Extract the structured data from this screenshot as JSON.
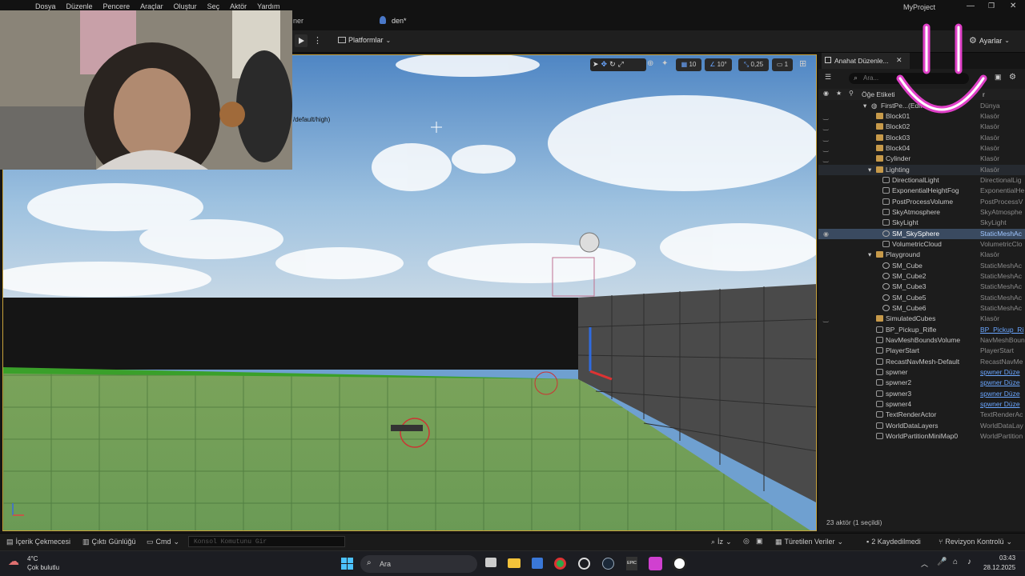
{
  "menu": [
    "Dosya",
    "Düzenle",
    "Pencere",
    "Araçlar",
    "Oluştur",
    "Seç",
    "Aktör",
    "Yardım"
  ],
  "window": {
    "project": "MyProject",
    "tab_partial": "ner",
    "level_tab": "den*"
  },
  "toolbar": {
    "platforms": "Platformlar",
    "settings": "Ayarlar"
  },
  "viewport": {
    "overlay_text": "/default/high)",
    "grid_value": "10",
    "rotation_value": "10°",
    "scale_value": "0,25",
    "camera_value": "1"
  },
  "outliner": {
    "tab_title": "Anahat Düzenle...",
    "search_placeholder": "Ara...",
    "col_label": "Öğe Etiketi",
    "col_type_partial": "r",
    "root": {
      "name": "FirstPe...(Editör)",
      "type": "Dünya"
    },
    "items": [
      {
        "name": "Block01",
        "type": "Klasör",
        "kind": "folder",
        "indent": 1,
        "eye": "closed"
      },
      {
        "name": "Block02",
        "type": "Klasör",
        "kind": "folder",
        "indent": 1,
        "eye": "closed"
      },
      {
        "name": "Block03",
        "type": "Klasör",
        "kind": "folder",
        "indent": 1,
        "eye": "closed"
      },
      {
        "name": "Block04",
        "type": "Klasör",
        "kind": "folder",
        "indent": 1,
        "eye": "closed"
      },
      {
        "name": "Cylinder",
        "type": "Klasör",
        "kind": "folder",
        "indent": 1,
        "eye": "closed"
      },
      {
        "name": "Lighting",
        "type": "Klasör",
        "kind": "folder-open",
        "indent": 1,
        "eye": "",
        "hl": true
      },
      {
        "name": "DirectionalLight",
        "type": "DirectionalLig",
        "kind": "actor",
        "indent": 2,
        "eye": ""
      },
      {
        "name": "ExponentialHeightFog",
        "type": "ExponentialHe",
        "kind": "actor",
        "indent": 2,
        "eye": ""
      },
      {
        "name": "PostProcessVolume",
        "type": "PostProcessV",
        "kind": "actor",
        "indent": 2,
        "eye": ""
      },
      {
        "name": "SkyAtmosphere",
        "type": "SkyAtmosphe",
        "kind": "actor",
        "indent": 2,
        "eye": ""
      },
      {
        "name": "SkyLight",
        "type": "SkyLight",
        "kind": "actor",
        "indent": 2,
        "eye": ""
      },
      {
        "name": "SM_SkySphere",
        "type": "StaticMeshAc",
        "kind": "mesh",
        "indent": 2,
        "eye": "open",
        "sel": true
      },
      {
        "name": "VolumetricCloud",
        "type": "VolumetricClo",
        "kind": "actor",
        "indent": 2,
        "eye": ""
      },
      {
        "name": "Playground",
        "type": "Klasör",
        "kind": "folder-open",
        "indent": 1,
        "eye": ""
      },
      {
        "name": "SM_Cube",
        "type": "StaticMeshAc",
        "kind": "mesh",
        "indent": 2,
        "eye": ""
      },
      {
        "name": "SM_Cube2",
        "type": "StaticMeshAc",
        "kind": "mesh",
        "indent": 2,
        "eye": ""
      },
      {
        "name": "SM_Cube3",
        "type": "StaticMeshAc",
        "kind": "mesh",
        "indent": 2,
        "eye": ""
      },
      {
        "name": "SM_Cube5",
        "type": "StaticMeshAc",
        "kind": "mesh",
        "indent": 2,
        "eye": ""
      },
      {
        "name": "SM_Cube6",
        "type": "StaticMeshAc",
        "kind": "mesh",
        "indent": 2,
        "eye": ""
      },
      {
        "name": "SimulatedCubes",
        "type": "Klasör",
        "kind": "folder",
        "indent": 1,
        "eye": "closed"
      },
      {
        "name": "BP_Pickup_Rifle",
        "type": "BP_Pickup_Ri",
        "kind": "actor",
        "indent": 1,
        "eye": "",
        "link": true
      },
      {
        "name": "NavMeshBoundsVolume",
        "type": "NavMeshBoun",
        "kind": "actor",
        "indent": 1,
        "eye": ""
      },
      {
        "name": "PlayerStart",
        "type": "PlayerStart",
        "kind": "actor",
        "indent": 1,
        "eye": ""
      },
      {
        "name": "RecastNavMesh-Default",
        "type": "RecastNavMe",
        "kind": "actor",
        "indent": 1,
        "eye": ""
      },
      {
        "name": "spwner",
        "type": "spwner Düze",
        "kind": "actor",
        "indent": 1,
        "eye": "",
        "link": true
      },
      {
        "name": "spwner2",
        "type": "spwner Düze",
        "kind": "actor",
        "indent": 1,
        "eye": "",
        "link": true
      },
      {
        "name": "spwner3",
        "type": "spwner Düze",
        "kind": "actor",
        "indent": 1,
        "eye": "",
        "link": true
      },
      {
        "name": "spwner4",
        "type": "spwner Düze",
        "kind": "actor",
        "indent": 1,
        "eye": "",
        "link": true
      },
      {
        "name": "TextRenderActor",
        "type": "TextRenderAc",
        "kind": "actor",
        "indent": 1,
        "eye": ""
      },
      {
        "name": "WorldDataLayers",
        "type": "WorldDataLay",
        "kind": "actor",
        "indent": 1,
        "eye": ""
      },
      {
        "name": "WorldPartitionMiniMap0",
        "type": "WorldPartition",
        "kind": "actor",
        "indent": 1,
        "eye": ""
      }
    ],
    "status": "23 aktör (1 seçildi)"
  },
  "bottom": {
    "content_drawer": "İçerik Çekmecesi",
    "output_log": "Çıktı Günlüğü",
    "cmd": "Cmd",
    "console_placeholder": "Konsol Komutunu Gir",
    "trace_partial": "İz",
    "derived_data": "Türetilen Veriler",
    "unsaved": "2 Kaydedilmedi",
    "revision": "Revizyon Kontrolü"
  },
  "taskbar": {
    "temp": "4°C",
    "weather": "Çok bulutlu",
    "search": "Ara",
    "time": "03:43",
    "date": "28.12.2025"
  },
  "colors": {
    "accent": "#c8a23a",
    "selection": "#3a4a60",
    "link": "#6aa6ff",
    "overlay_pink": "#e040c8"
  }
}
